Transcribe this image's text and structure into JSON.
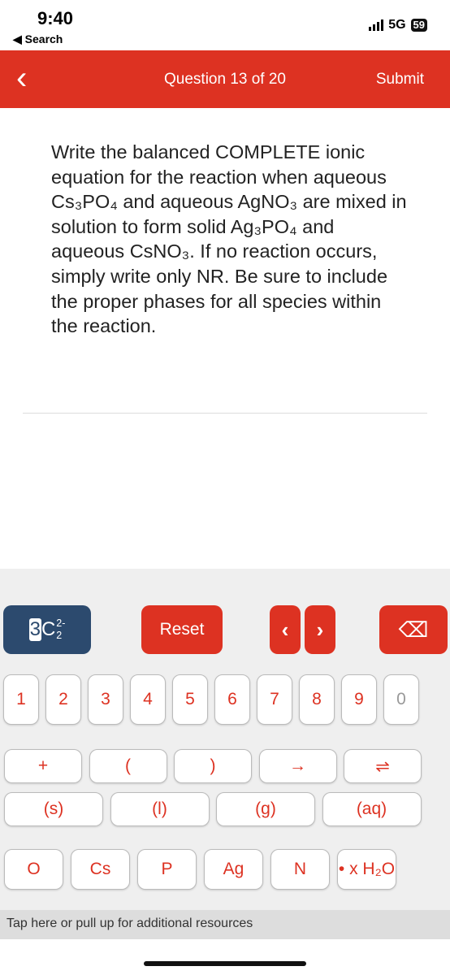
{
  "status": {
    "time": "9:40",
    "back_app": "◀ Search",
    "network": "5G",
    "battery": "59"
  },
  "header": {
    "back": "‹",
    "title": "Question 13 of 20",
    "submit": "Submit"
  },
  "question": "Write the balanced COMPLETE ionic equation for the reaction when aqueous Cs₃PO₄ and aqueous AgNO₃ are mixed in solution to form solid Ag₃PO₄ and aqueous CsNO₃. If no reaction occurs, simply write only NR. Be sure to include the proper phases for all species within the reaction.",
  "keyboard": {
    "formula_key": {
      "coef": "3",
      "elem": "C",
      "sub": "2",
      "charge": "2-"
    },
    "reset": "Reset",
    "prev": "‹",
    "next": "›",
    "delete": "⌫",
    "digits": [
      "1",
      "2",
      "3",
      "4",
      "5",
      "6",
      "7",
      "8",
      "9",
      "0"
    ],
    "symbols": [
      "+",
      "(",
      ")",
      "→",
      "⇌"
    ],
    "phases": [
      "(s)",
      "(l)",
      "(g)",
      "(aq)"
    ],
    "elements": [
      "O",
      "Cs",
      "P",
      "Ag",
      "N",
      "• x H₂O"
    ]
  },
  "resources": "Tap here or pull up for additional resources",
  "colors": {
    "accent": "#dd3222",
    "formula_key": "#2c4a6e"
  }
}
